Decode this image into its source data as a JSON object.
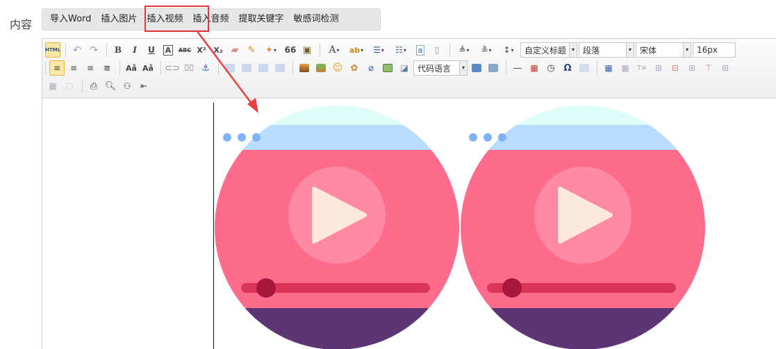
{
  "field": {
    "label": "内容"
  },
  "top_buttons": [
    "导入Word",
    "插入图片",
    "插入视频",
    "插入音频",
    "提取关键字",
    "敏感词检测"
  ],
  "highlighted_button": "插入视频",
  "toolbar": {
    "html_label": "HTML",
    "bold": "B",
    "italic": "I",
    "underline": "U",
    "border_a": "A",
    "strike": "ABC",
    "superscript": "X²",
    "subscript": "X₂",
    "quote": "66",
    "font_color": "A",
    "omega": "Ω",
    "heading_select": "自定义标题",
    "paragraph_select": "段落",
    "font_select": "宋体",
    "size_select": "16px",
    "code_select": "代码语言"
  },
  "colors": {
    "accent_red": "#e0353a",
    "video_pink": "#ff6b8b",
    "video_bg": "#dcfdf8",
    "video_bar": "#b8dcff",
    "video_footer": "#5d3574"
  },
  "content": {
    "videos": [
      {
        "icon": "video-thumbnail-icon"
      },
      {
        "icon": "video-thumbnail-icon"
      }
    ]
  }
}
